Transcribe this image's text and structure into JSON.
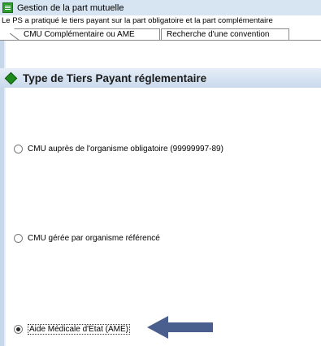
{
  "window": {
    "title": "Gestion de la part mutuelle",
    "icon": "app-green-icon"
  },
  "info_text": "Le PS a pratiqué le tiers payant sur la part obligatoire et la part complémentaire",
  "tabs": [
    {
      "label": "CMU Complémentaire ou AME",
      "active": true
    },
    {
      "label": "Recherche d'une convention",
      "active": false
    }
  ],
  "section": {
    "title": "Type de Tiers Payant réglementaire",
    "icon": "green-diamond-icon"
  },
  "options": [
    {
      "label": "CMU auprès de l'organisme obligatoire (99999997-89)",
      "selected": false
    },
    {
      "label": "CMU gérée par organisme référencé",
      "selected": false
    },
    {
      "label": "Aide Médicale d'Etat (AME)",
      "selected": true
    }
  ],
  "colors": {
    "accent_green": "#1e8a1e",
    "header_blue": "#c9d9ec",
    "arrow": "#4a5f8d"
  }
}
